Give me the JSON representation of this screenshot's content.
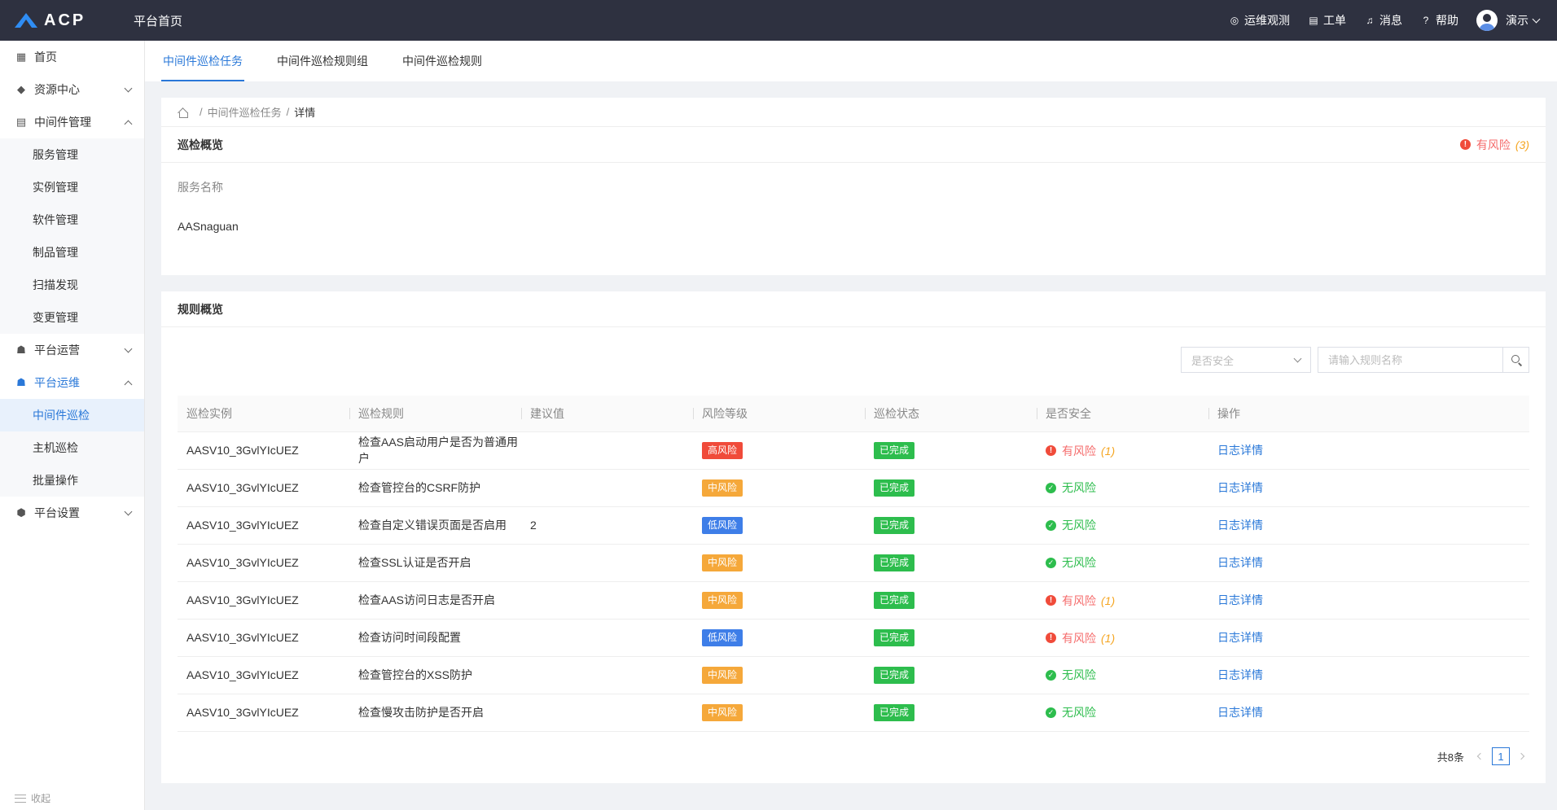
{
  "topbar": {
    "logo_text": "ACP",
    "title": "平台首页",
    "items": [
      {
        "label": "运维观测",
        "icon": "observe-icon"
      },
      {
        "label": "工单",
        "icon": "ticket-icon"
      },
      {
        "label": "消息",
        "icon": "bell-icon"
      },
      {
        "label": "帮助",
        "icon": "help-icon"
      }
    ],
    "user": "演示"
  },
  "sidebar": {
    "items": [
      {
        "label": "首页",
        "icon": "grid-icon"
      },
      {
        "label": "资源中心",
        "icon": "cube-icon"
      },
      {
        "label": "中间件管理",
        "icon": "middleware-icon"
      },
      {
        "label": "服务管理"
      },
      {
        "label": "实例管理"
      },
      {
        "label": "软件管理"
      },
      {
        "label": "制品管理"
      },
      {
        "label": "扫描发现"
      },
      {
        "label": "变更管理"
      },
      {
        "label": "平台运营",
        "icon": "user-group-icon"
      },
      {
        "label": "平台运维",
        "icon": "user-ops-icon"
      },
      {
        "label": "中间件巡检"
      },
      {
        "label": "主机巡检"
      },
      {
        "label": "批量操作"
      },
      {
        "label": "平台设置",
        "icon": "settings-icon"
      }
    ],
    "collapse_label": "收起"
  },
  "tabs": [
    {
      "label": "中间件巡检任务"
    },
    {
      "label": "中间件巡检规则组"
    },
    {
      "label": "中间件巡检规则"
    }
  ],
  "breadcrumb": {
    "parent": "中间件巡检任务",
    "current": "详情"
  },
  "overview": {
    "title": "巡检概览",
    "risk_label": "有风险",
    "risk_count": "(3)",
    "field_label": "服务名称",
    "field_value": "AASnaguan"
  },
  "rules": {
    "title": "规则概览",
    "safe_select_placeholder": "是否安全",
    "search_placeholder": "请输入规则名称",
    "columns": [
      "巡检实例",
      "巡检规则",
      "建议值",
      "风险等级",
      "巡检状态",
      "是否安全",
      "操作"
    ],
    "rows": [
      {
        "instance": "AASV10_3GvlYIcUEZ",
        "rule": "检查AAS启动用户是否为普通用户",
        "suggest": "",
        "level": "高风险",
        "status": "已完成",
        "safe": "有风险",
        "safe_count": "(1)",
        "action": "日志详情"
      },
      {
        "instance": "AASV10_3GvlYIcUEZ",
        "rule": "检查管控台的CSRF防护",
        "suggest": "",
        "level": "中风险",
        "status": "已完成",
        "safe": "无风险",
        "safe_count": "",
        "action": "日志详情"
      },
      {
        "instance": "AASV10_3GvlYIcUEZ",
        "rule": "检查自定义错误页面是否启用",
        "suggest": "2",
        "level": "低风险",
        "status": "已完成",
        "safe": "无风险",
        "safe_count": "",
        "action": "日志详情"
      },
      {
        "instance": "AASV10_3GvlYIcUEZ",
        "rule": "检查SSL认证是否开启",
        "suggest": "",
        "level": "中风险",
        "status": "已完成",
        "safe": "无风险",
        "safe_count": "",
        "action": "日志详情"
      },
      {
        "instance": "AASV10_3GvlYIcUEZ",
        "rule": "检查AAS访问日志是否开启",
        "suggest": "",
        "level": "中风险",
        "status": "已完成",
        "safe": "有风险",
        "safe_count": "(1)",
        "action": "日志详情"
      },
      {
        "instance": "AASV10_3GvlYIcUEZ",
        "rule": "检查访问时间段配置",
        "suggest": "",
        "level": "低风险",
        "status": "已完成",
        "safe": "有风险",
        "safe_count": "(1)",
        "action": "日志详情"
      },
      {
        "instance": "AASV10_3GvlYIcUEZ",
        "rule": "检查管控台的XSS防护",
        "suggest": "",
        "level": "中风险",
        "status": "已完成",
        "safe": "无风险",
        "safe_count": "",
        "action": "日志详情"
      },
      {
        "instance": "AASV10_3GvlYIcUEZ",
        "rule": "检查慢攻击防护是否开启",
        "suggest": "",
        "level": "中风险",
        "status": "已完成",
        "safe": "无风险",
        "safe_count": "",
        "action": "日志详情"
      }
    ]
  },
  "pagination": {
    "total_label": "共8条",
    "current_page": "1"
  },
  "colors": {
    "accent": "#2a78d8",
    "topbar_bg": "#2e3140",
    "high_risk": "#f04b3a",
    "mid_risk": "#f5a83a",
    "low_risk": "#3e7ee8",
    "done": "#2dbd4d"
  }
}
